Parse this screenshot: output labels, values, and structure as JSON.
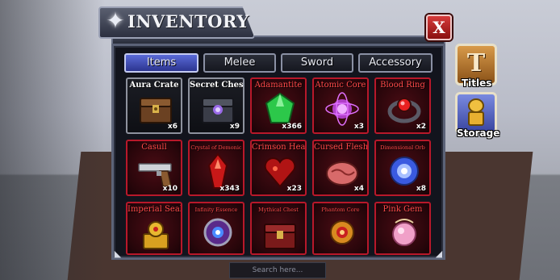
{
  "window": {
    "title": "INVENTORY",
    "close_label": "X"
  },
  "tabs": [
    {
      "label": "Items",
      "active": true
    },
    {
      "label": "Melee",
      "active": false
    },
    {
      "label": "Sword",
      "active": false
    },
    {
      "label": "Accessory",
      "active": false
    }
  ],
  "items": [
    {
      "name": "Aura Crate",
      "count": "x6",
      "icon": "crate-icon",
      "style": "gray"
    },
    {
      "name": "Secret Chest",
      "count": "x9",
      "icon": "chest-icon",
      "style": "gray"
    },
    {
      "name": "Adamantite",
      "count": "x366",
      "icon": "green-gem-icon",
      "style": "red"
    },
    {
      "name": "Atomic Core",
      "count": "x3",
      "icon": "atom-orb-icon",
      "style": "red"
    },
    {
      "name": "Blood Ring",
      "count": "x2",
      "icon": "ring-icon",
      "style": "red"
    },
    {
      "name": "Casull",
      "count": "x10",
      "icon": "pistol-icon",
      "style": "red"
    },
    {
      "name": "Crystal of Demonic",
      "count": "x343",
      "icon": "red-crystal-icon",
      "style": "red"
    },
    {
      "name": "Crimson Heart",
      "count": "x23",
      "icon": "heart-icon",
      "style": "red"
    },
    {
      "name": "Cursed Flesh",
      "count": "x4",
      "icon": "flesh-icon",
      "style": "red"
    },
    {
      "name": "Dimensional Orb",
      "count": "x8",
      "icon": "blue-orb-icon",
      "style": "red"
    },
    {
      "name": "Imperial Seal",
      "count": "",
      "icon": "seal-icon",
      "style": "red"
    },
    {
      "name": "Infinity Essence",
      "count": "",
      "icon": "essence-icon",
      "style": "red"
    },
    {
      "name": "Mythical Chest",
      "count": "",
      "icon": "mythical-chest-icon",
      "style": "red"
    },
    {
      "name": "Phantom Core",
      "count": "",
      "icon": "phantom-core-icon",
      "style": "red"
    },
    {
      "name": "Pink Gem",
      "count": "",
      "icon": "pink-gem-icon",
      "style": "red"
    }
  ],
  "side_buttons": {
    "titles_label": "Titles",
    "titles_glyph": "T",
    "storage_label": "Storage"
  },
  "search": {
    "placeholder": "Search here..."
  },
  "colors": {
    "slot_border_red": "#b8182a",
    "slot_border_gray": "#8e929e",
    "tab_active": "#4656c4",
    "close_red": "#c02424"
  }
}
